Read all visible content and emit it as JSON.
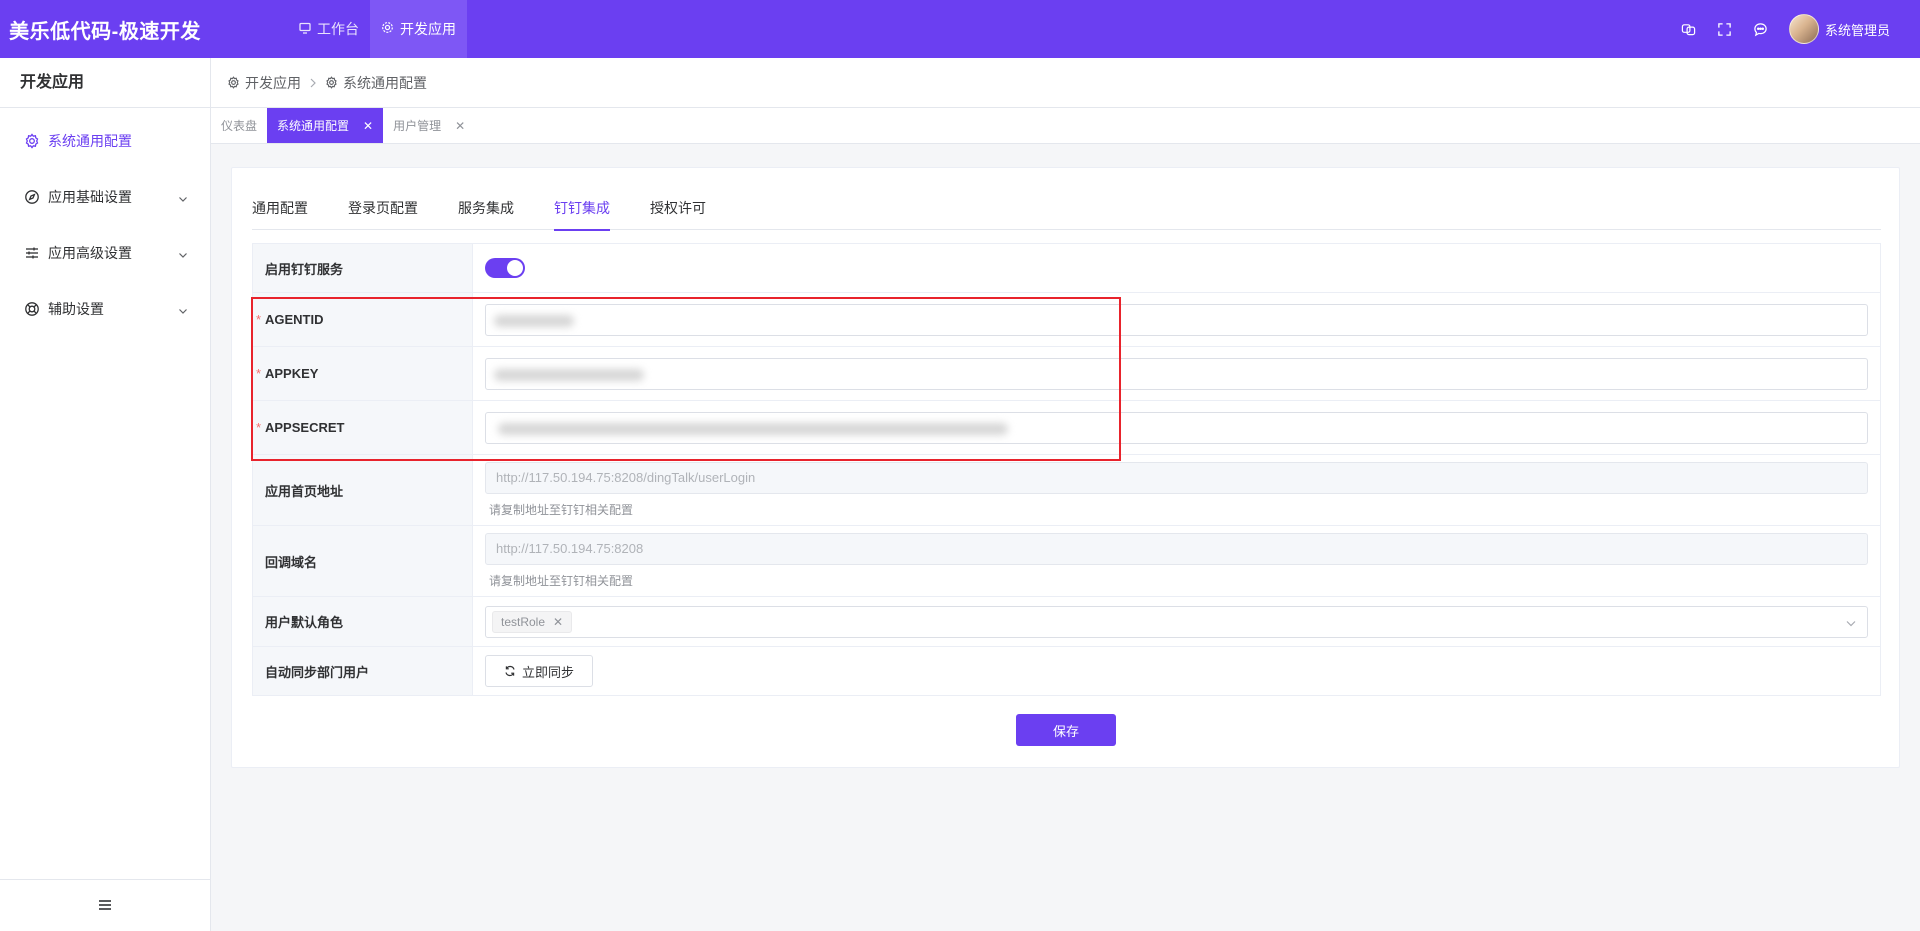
{
  "header": {
    "brand": "美乐低代码-极速开发",
    "tabs": [
      {
        "label": "工作台",
        "icon": "monitor-icon"
      },
      {
        "label": "开发应用",
        "icon": "gear-icon"
      }
    ],
    "user_name": "系统管理员",
    "icons": [
      "translate-icon",
      "fullscreen-icon",
      "message-icon"
    ]
  },
  "sidebar": {
    "title": "开发应用",
    "items": [
      {
        "label": "系统通用配置",
        "icon": "gear-icon"
      },
      {
        "label": "应用基础设置",
        "icon": "compass-icon"
      },
      {
        "label": "应用高级设置",
        "icon": "sliders-icon"
      },
      {
        "label": "辅助设置",
        "icon": "lifebuoy-icon"
      }
    ]
  },
  "breadcrumb": [
    "开发应用",
    "系统通用配置"
  ],
  "tags": [
    "仪表盘",
    "系统通用配置",
    "用户管理"
  ],
  "tabs": [
    "通用配置",
    "登录页配置",
    "服务集成",
    "钉钉集成",
    "授权许可"
  ],
  "active_tab": "钉钉集成",
  "form": {
    "enable_label": "启用钉钉服务",
    "enable_value": true,
    "agentid_label": "AGENTID",
    "appkey_label": "APPKEY",
    "appsecret_label": "APPSECRET",
    "required_mark": "*",
    "home_label": "应用首页地址",
    "home_value": "http://117.50.194.75:8208/dingTalk/userLogin",
    "home_hint": "请复制地址至钉钉相关配置",
    "callback_label": "回调域名",
    "callback_value": "http://117.50.194.75:8208",
    "callback_hint": "请复制地址至钉钉相关配置",
    "role_label": "用户默认角色",
    "role_value": "testRole",
    "sync_label": "自动同步部门用户",
    "sync_button": "立即同步"
  },
  "save_button": "保存",
  "colors": {
    "accent": "#6b3ff1",
    "highlight": "#e8232c",
    "required": "#f56c6c"
  }
}
